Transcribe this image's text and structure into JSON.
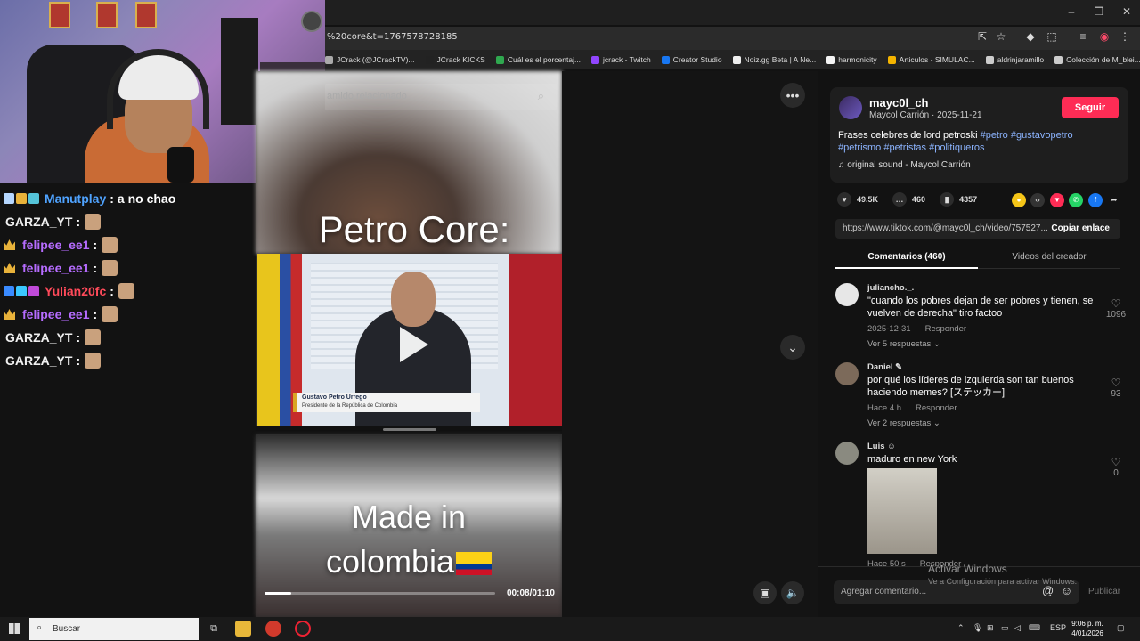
{
  "browser": {
    "url_fragment": "%20core&t=1767578728185",
    "window_controls": [
      "–",
      "❐",
      "✕"
    ],
    "bookmarks": [
      {
        "label": "JCrack (@JCrackTV)...",
        "color": "#aaaaaa"
      },
      {
        "label": "JCrack KICKS",
        "color": "#222222"
      },
      {
        "label": "Cuál es el porcentaj...",
        "color": "#2fa84f"
      },
      {
        "label": "jcrack - Twitch",
        "color": "#9146ff"
      },
      {
        "label": "Creator Studio",
        "color": "#1877f2"
      },
      {
        "label": "Noiz.gg Beta | A Ne...",
        "color": "#eeeeee"
      },
      {
        "label": "harmonicity",
        "color": "#f4f4f4"
      },
      {
        "label": "Articulos - SIMULAC...",
        "color": "#f4b400"
      },
      {
        "label": "aldrinjaramillo",
        "color": "#cccccc"
      },
      {
        "label": "Colección de M_blei...",
        "color": "#cccccc"
      }
    ]
  },
  "chat": [
    {
      "user": "Manutplay",
      "color": "#4fa3ff",
      "badges": [
        "#b6d7ff",
        "#e8b23a",
        "#55c4d9"
      ],
      "text": "a no chao",
      "emote": false,
      "crown": false
    },
    {
      "user": "GARZA_YT",
      "color": "#f0f0f0",
      "badges": [],
      "text": "",
      "emote": true,
      "crown": false
    },
    {
      "user": "felipee_ee1",
      "color": "#b66cff",
      "badges": [],
      "text": "",
      "emote": true,
      "crown": true
    },
    {
      "user": "felipee_ee1",
      "color": "#b66cff",
      "badges": [],
      "text": "",
      "emote": true,
      "crown": true
    },
    {
      "user": "Yulian20fc",
      "color": "#ff4a5a",
      "badges": [
        "#3a8bff",
        "#3ac7ff",
        "#c04ad9"
      ],
      "text": "",
      "emote": true,
      "crown": false
    },
    {
      "user": "felipee_ee1",
      "color": "#b66cff",
      "badges": [],
      "text": "",
      "emote": true,
      "crown": true
    },
    {
      "user": "GARZA_YT",
      "color": "#f0f0f0",
      "badges": [],
      "text": "",
      "emote": true,
      "crown": false
    },
    {
      "user": "GARZA_YT",
      "color": "#f0f0f0",
      "badges": [],
      "text": "",
      "emote": true,
      "crown": false
    }
  ],
  "video": {
    "search_placeholder": "amido relacionado",
    "caption_top": "Petro Core:",
    "lower_third_name": "Gustavo Petro Urrego",
    "lower_third_title": "Presidente de la República de Colombia",
    "caption_bottom_line1": "Made in",
    "caption_bottom_line2": "colombia",
    "timecode": "00:08/01:10",
    "progress": 0.114
  },
  "post": {
    "username": "mayc0l_ch",
    "subline": "Maycol Carrión · 2025-11-21",
    "follow_label": "Seguir",
    "desc_text": "Frases celebres de lord petroski ",
    "hashtags": [
      "#petro",
      "#gustavopetro",
      "#petrismo",
      "#petristas",
      "#politiqueros"
    ],
    "sound": "♫  original sound - Maycol Carrión",
    "likes": "49.5K",
    "comments_count": "460",
    "saves": "4357",
    "link": "https://www.tiktok.com/@mayc0l_ch/video/757527...",
    "copy_label": "Copiar enlace",
    "tab_comments": "Comentarios (460)",
    "tab_videos": "Videos del creador"
  },
  "comments": [
    {
      "user": "juliancho._.",
      "text": "\"cuando los pobres dejan de ser pobres y tienen, se vuelven de derecha\" tiro factoo",
      "date": "2025-12-31",
      "reply": "Responder",
      "replies": "Ver 5 respuestas ⌄",
      "likes": "1096"
    },
    {
      "user": "Daniel ✎",
      "text": "por qué los líderes de izquierda son tan buenos haciendo memes? [ステッカー]",
      "date": "Hace 4 h",
      "reply": "Responder",
      "replies": "Ver 2 respuestas ⌄",
      "likes": "93"
    },
    {
      "user": "Luis ☺",
      "text": "maduro en new York",
      "date": "Hace 50 s",
      "reply": "Responder",
      "replies": "",
      "likes": "0"
    }
  ],
  "comment_input": {
    "placeholder": "Agregar comentario...",
    "publish": "Publicar"
  },
  "watermark": {
    "line1": "Activar Windows",
    "line2": "Ve a Configuración para activar Windows."
  },
  "taskbar": {
    "search_placeholder": "Buscar",
    "lang": "ESP",
    "time": "9:06 p. m.",
    "date": "4/01/2026"
  }
}
